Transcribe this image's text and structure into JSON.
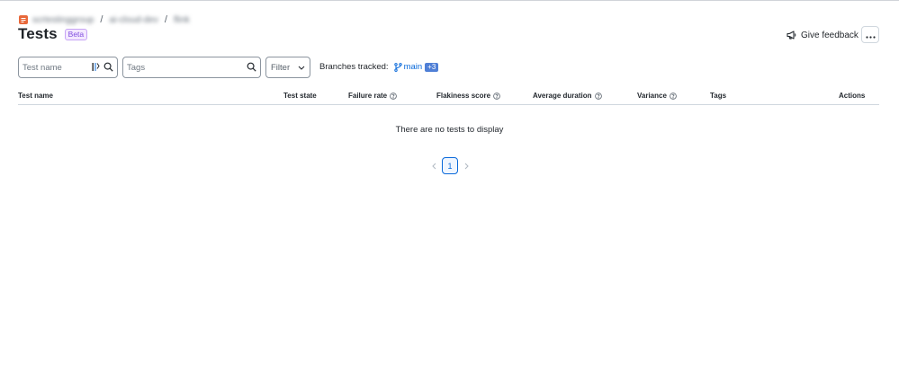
{
  "breadcrumb": {
    "items": [
      "scrtestinggroup",
      "ai-cloud-dev",
      "flink"
    ],
    "separator": "/"
  },
  "header": {
    "title": "Tests",
    "badge": "Beta",
    "feedback_label": "Give feedback",
    "more_icon": "more-horizontal-icon"
  },
  "filters": {
    "test_name_placeholder": "Test name",
    "tags_placeholder": "Tags",
    "filter_label": "Filter",
    "branches_label": "Branches tracked:",
    "branch_name": "main",
    "branch_extra": "+3"
  },
  "table": {
    "columns": [
      "Test name",
      "Test state",
      "Failure rate",
      "Flakiness score",
      "Average duration",
      "Variance",
      "Tags",
      "Actions"
    ],
    "empty_message": "There are no tests to display"
  },
  "pagination": {
    "current_page": "1"
  },
  "colors": {
    "accent": "#0969da",
    "badge": "#8250df",
    "logo": "#e8683a"
  }
}
